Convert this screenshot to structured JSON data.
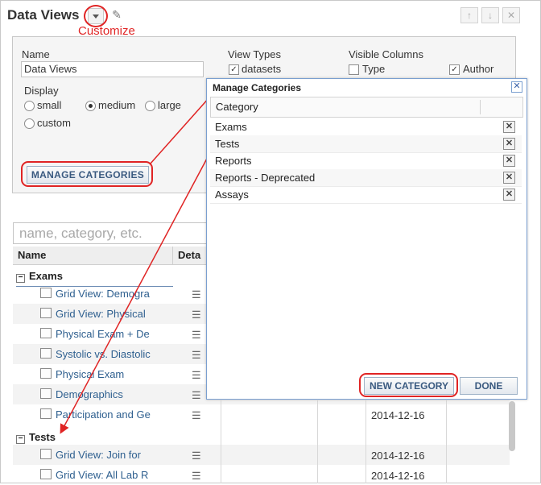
{
  "panel_title": "Data Views",
  "annotation": "Customize",
  "icons": {
    "dropdown": "caret-down-icon",
    "edit": "pencil-icon",
    "up": "arrow-up-icon",
    "down": "arrow-down-icon",
    "close": "close-icon",
    "delete": "delete-x-icon",
    "details": "list-icon"
  },
  "colors": {
    "annotation_red": "#e02424",
    "link_blue": "#2e5f8f",
    "modal_border": "#7a9fd0"
  },
  "customize": {
    "name_label": "Name",
    "name_value": "Data Views",
    "display_label": "Display",
    "display_options": [
      "small",
      "medium",
      "large",
      "custom"
    ],
    "display_selected": "medium",
    "view_types_label": "View Types",
    "view_types_items": [
      "datasets"
    ],
    "visible_columns_label": "Visible Columns",
    "visible_columns_items": [
      "Type",
      "Author"
    ],
    "manage_button": "MANAGE CATEGORIES"
  },
  "search": {
    "placeholder": "name, category, etc."
  },
  "grid": {
    "columns": [
      "Name",
      "Deta"
    ],
    "groups": [
      {
        "name": "Exams",
        "items": [
          {
            "name": "Grid View: Demogra"
          },
          {
            "name": "Grid View: Physical"
          },
          {
            "name": "Physical Exam + De"
          },
          {
            "name": "Systolic vs. Diastolic"
          },
          {
            "name": "Physical Exam"
          },
          {
            "name": "Demographics"
          },
          {
            "name": "Participation and Ge",
            "date": "2014-12-16"
          }
        ]
      },
      {
        "name": "Tests",
        "items": [
          {
            "name": "Grid View: Join for",
            "date": "2014-12-16"
          },
          {
            "name": "Grid View: All Lab R",
            "date": "2014-12-16"
          }
        ]
      }
    ]
  },
  "modal": {
    "title": "Manage Categories",
    "column": "Category",
    "categories": [
      "Exams",
      "Tests",
      "Reports",
      "Reports - Deprecated",
      "Assays"
    ],
    "new_button": "NEW CATEGORY",
    "done_button": "DONE"
  }
}
